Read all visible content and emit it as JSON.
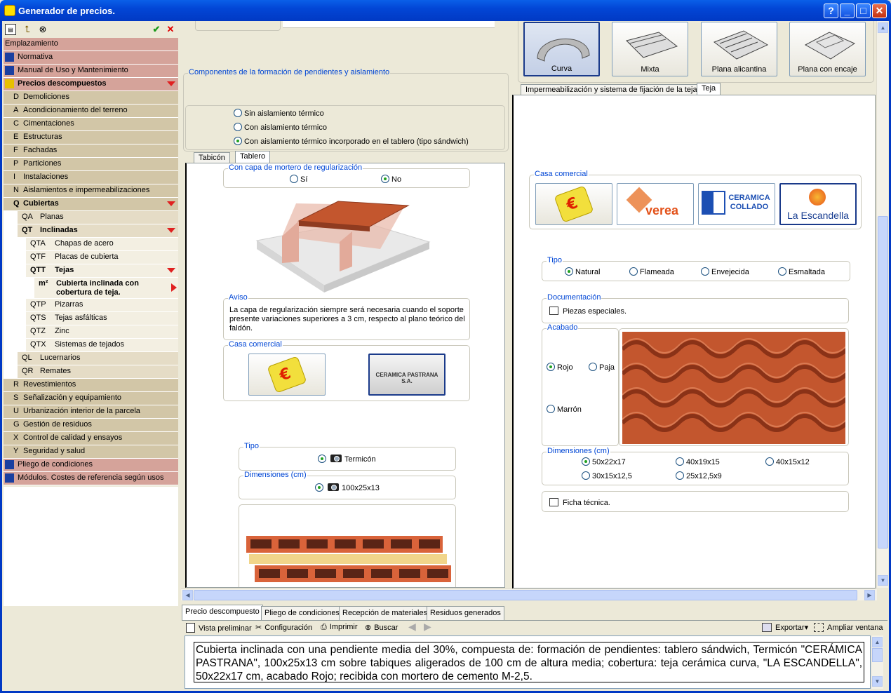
{
  "window": {
    "title": "Generador de precios.",
    "help": "?",
    "minimize": "_",
    "maximize": "□",
    "close": "✕"
  },
  "left_toolbar": {
    "ok": "✔",
    "cancel": "✕"
  },
  "tree": [
    {
      "code": "",
      "label": "Emplazamiento",
      "level": 0
    },
    {
      "code": "",
      "label": "Normativa",
      "level": 0,
      "icon": "book-icon"
    },
    {
      "code": "",
      "label": "Manual de Uso y Mantenimiento",
      "level": 0,
      "icon": "manual-icon"
    },
    {
      "code": "",
      "label": "Precios descompuestos",
      "level": 0,
      "bold": true,
      "expanded": true,
      "icon": "prices-icon"
    },
    {
      "code": "D",
      "label": "Demoliciones",
      "level": 1
    },
    {
      "code": "A",
      "label": "Acondicionamiento del terreno",
      "level": 1
    },
    {
      "code": "C",
      "label": "Cimentaciones",
      "level": 1
    },
    {
      "code": "E",
      "label": "Estructuras",
      "level": 1
    },
    {
      "code": "F",
      "label": "Fachadas",
      "level": 1
    },
    {
      "code": "P",
      "label": "Particiones",
      "level": 1
    },
    {
      "code": "I",
      "label": "Instalaciones",
      "level": 1
    },
    {
      "code": "N",
      "label": "Aislamientos e impermeabilizaciones",
      "level": 1
    },
    {
      "code": "Q",
      "label": "Cubiertas",
      "level": 1,
      "bold": true,
      "expanded": true
    },
    {
      "code": "QA",
      "label": "Planas",
      "level": 2
    },
    {
      "code": "QT",
      "label": "Inclinadas",
      "level": 2,
      "bold": true,
      "expanded": true
    },
    {
      "code": "QTA",
      "label": "Chapas de acero",
      "level": 3
    },
    {
      "code": "QTF",
      "label": "Placas de cubierta",
      "level": 3
    },
    {
      "code": "QTT",
      "label": "Tejas",
      "level": 3,
      "bold": true,
      "expanded": true
    },
    {
      "code": "m²",
      "label": "Cubierta inclinada con cobertura de teja.",
      "level": 4,
      "bold": true,
      "selected": true
    },
    {
      "code": "QTP",
      "label": "Pizarras",
      "level": 3
    },
    {
      "code": "QTS",
      "label": "Tejas asfálticas",
      "level": 3
    },
    {
      "code": "QTZ",
      "label": "Zinc",
      "level": 3
    },
    {
      "code": "QTX",
      "label": "Sistemas de tejados",
      "level": 3
    },
    {
      "code": "QL",
      "label": "Lucernarios",
      "level": 2
    },
    {
      "code": "QR",
      "label": "Remates",
      "level": 2
    },
    {
      "code": "R",
      "label": "Revestimientos",
      "level": 1
    },
    {
      "code": "S",
      "label": "Señalización y equipamiento",
      "level": 1
    },
    {
      "code": "U",
      "label": "Urbanización interior de la parcela",
      "level": 1
    },
    {
      "code": "G",
      "label": "Gestión de residuos",
      "level": 1
    },
    {
      "code": "X",
      "label": "Control de calidad y ensayos",
      "level": 1
    },
    {
      "code": "Y",
      "label": "Seguridad y salud",
      "level": 1
    },
    {
      "code": "",
      "label": "Pliego de condiciones",
      "level": 0,
      "icon": "document-icon"
    },
    {
      "code": "",
      "label": "Módulos. Costes de referencia según usos",
      "level": 0,
      "icon": "chart-icon"
    }
  ],
  "middle": {
    "group_title": "Componentes de la formación de pendientes y aislamiento",
    "aislamiento_options": [
      "Sin aislamiento térmico",
      "Con aislamiento térmico",
      "Con aislamiento térmico incorporado en el tablero (tipo sándwich)"
    ],
    "tabs": [
      "Tabicón",
      "Tablero"
    ],
    "mortero": {
      "title": "Con capa de mortero de regularización",
      "si": "Sí",
      "no": "No"
    },
    "aviso": {
      "title": "Aviso",
      "text": "La capa de regularización siempre será necesaria cuando el soporte presente variaciones superiores a 3 cm, respecto al plano teórico del faldón."
    },
    "casa": {
      "title": "Casa comercial",
      "brand": "CERAMICA PASTRANA S.A."
    },
    "tipo": {
      "title": "Tipo",
      "value": "Termicón"
    },
    "dimensiones": {
      "title": "Dimensiones (cm)",
      "value": "100x25x13"
    }
  },
  "right": {
    "teja_buttons": [
      "Curva",
      "Mixta",
      "Plana alicantina",
      "Plana con encaje"
    ],
    "tabs": [
      "Impermeabilización y sistema de fijación de la teja",
      "Teja"
    ],
    "casa": {
      "title": "Casa comercial",
      "brands": [
        "verea",
        "CERAMICA COLLADO",
        "La Escandella"
      ]
    },
    "tipo": {
      "title": "Tipo",
      "options": [
        "Natural",
        "Flameada",
        "Envejecida",
        "Esmaltada"
      ]
    },
    "documentacion": {
      "title": "Documentación",
      "item": "Piezas especiales."
    },
    "acabado": {
      "title": "Acabado",
      "options": [
        "Rojo",
        "Paja",
        "Marrón"
      ]
    },
    "dimensiones": {
      "title": "Dimensiones (cm)",
      "options": [
        "50x22x17",
        "40x19x15",
        "40x15x12",
        "30x15x12,5",
        "25x12,5x9"
      ]
    },
    "ficha": "Ficha técnica."
  },
  "bottom": {
    "tabs": [
      "Precio descompuesto",
      "Pliego de condiciones",
      "Recepción de materiales",
      "Residuos generados"
    ],
    "toolbar": {
      "preview": "Vista preliminar",
      "config": "Configuración",
      "print": "Imprimir",
      "search": "Buscar",
      "export": "Exportar▾",
      "expand": "Ampliar ventana"
    },
    "description": "Cubierta inclinada con una pendiente media del 30%, compuesta de: formación de pendientes: tablero sándwich, Termicón \"CERÁMICA PASTRANA\", 100x25x13 cm sobre tabiques aligerados de 100 cm de altura media; cobertura: teja cerámica curva, \"LA ESCANDELLA\", 50x22x17 cm, acabado Rojo; recibida con mortero de cemento M-2,5."
  },
  "colors": {
    "title_bar": "#0246d6",
    "tree_root": "#d5a39a",
    "tree_l1": "#d2c6a7",
    "tree_l2": "#e5dcc6",
    "tree_l3": "#f3efe2",
    "group_label": "#0046d5",
    "tile": "#c3562e"
  }
}
